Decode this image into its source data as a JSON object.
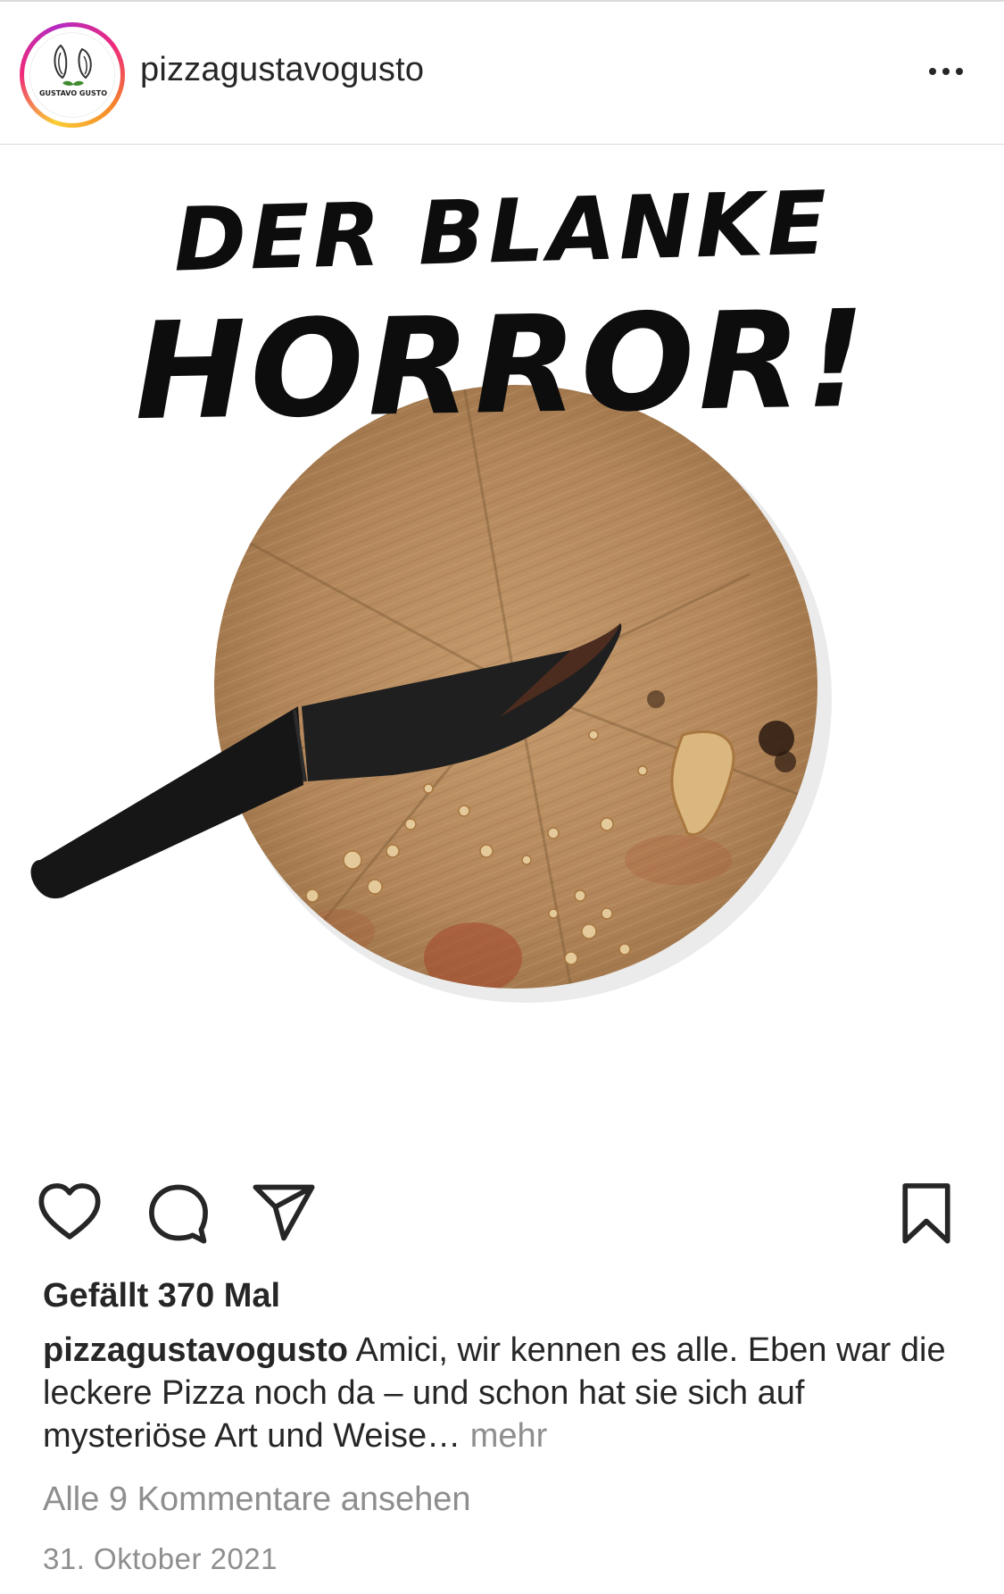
{
  "post": {
    "username": "pizzagustavogusto",
    "avatar_icon": "gustavo-gusto-logo",
    "avatar_text": "GUSTAVO GUSTO",
    "more_icon": "more-horizontal-icon",
    "image": {
      "headline_line1": "DER BLANKE",
      "headline_line2": "HORROR!",
      "description_icon": "empty-pizza-board-with-knife"
    },
    "actions": {
      "like_icon": "heart-icon",
      "comment_icon": "comment-icon",
      "share_icon": "paper-plane-icon",
      "save_icon": "bookmark-icon"
    },
    "likes_text": "Gefällt 370 Mal",
    "caption": {
      "username": "pizzagustavogusto",
      "text": " Amici, wir kennen es alle. Eben war die leckere Pizza noch da – und schon hat sie sich auf mysteriöse Art und Weise…",
      "more_label": " mehr"
    },
    "view_comments": "Alle 9 Kommentare ansehen",
    "date": "31. Oktober 2021"
  },
  "colors": {
    "text": "#262626",
    "secondary": "#8e8e8e",
    "divider": "#dbdbdb",
    "board": "#b98a5a",
    "knife": "#1c1c1c"
  }
}
